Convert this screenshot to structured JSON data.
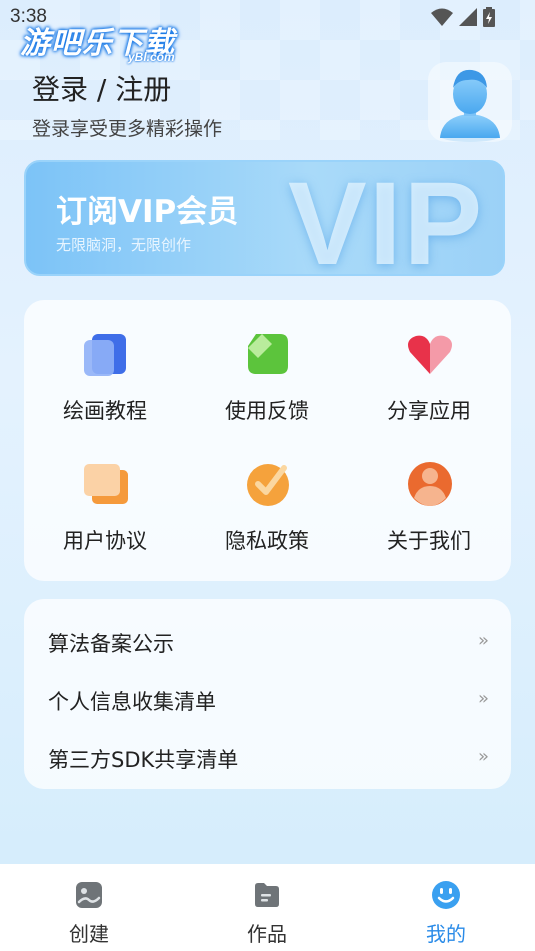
{
  "status_bar": {
    "time": "3:38"
  },
  "watermark": {
    "text": "游吧乐下载",
    "sub": "yBl.com"
  },
  "header": {
    "title": "登录 / 注册",
    "subtitle": "登录享受更多精彩操作"
  },
  "vip": {
    "title": "订阅VIP会员",
    "subtitle": "无限脑洞，无限创作",
    "big_text": "VIP"
  },
  "grid": [
    {
      "label": "绘画教程",
      "icon": "tutorial-icon"
    },
    {
      "label": "使用反馈",
      "icon": "feedback-icon"
    },
    {
      "label": "分享应用",
      "icon": "heart-icon"
    },
    {
      "label": "用户协议",
      "icon": "agreement-icon"
    },
    {
      "label": "隐私政策",
      "icon": "privacy-check-icon"
    },
    {
      "label": "关于我们",
      "icon": "about-person-icon"
    }
  ],
  "list": [
    {
      "label": "算法备案公示",
      "chevron": "»"
    },
    {
      "label": "个人信息收集清单",
      "chevron": "»"
    },
    {
      "label": "第三方SDK共享清单",
      "chevron": "»"
    }
  ],
  "tabs": [
    {
      "label": "创建",
      "icon": "create-icon"
    },
    {
      "label": "作品",
      "icon": "works-icon"
    },
    {
      "label": "我的",
      "icon": "smiley-icon",
      "active": true
    }
  ],
  "colors": {
    "accent": "#2a8be8",
    "vip_bg": "#7cc3f7"
  }
}
